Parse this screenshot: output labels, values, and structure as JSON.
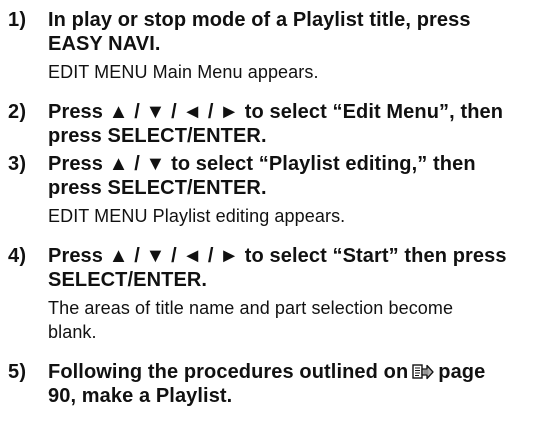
{
  "steps": [
    {
      "number": "1)",
      "instruction": "In play or stop mode of a Playlist title, press\nEASY NAVI.",
      "result": "EDIT MENU Main Menu appears."
    },
    {
      "number": "2)",
      "instruction": "Press ▲ / ▼ / ◄ / ► to select “Edit Menu”, then\npress SELECT/ENTER."
    },
    {
      "number": "3)",
      "instruction": "Press ▲ / ▼ to select “Playlist editing,” then\npress SELECT/ENTER.",
      "result": "EDIT MENU Playlist editing appears."
    },
    {
      "number": "4)",
      "instruction": "Press ▲ / ▼ / ◄ / ► to select “Start” then press\nSELECT/ENTER.",
      "result": "The areas of title name and part selection become\nblank."
    },
    {
      "number": "5)",
      "instruction_before": "Following the procedures outlined on",
      "icon": "page-reference-icon",
      "instruction_after": "page\n90, make a Playlist."
    }
  ]
}
